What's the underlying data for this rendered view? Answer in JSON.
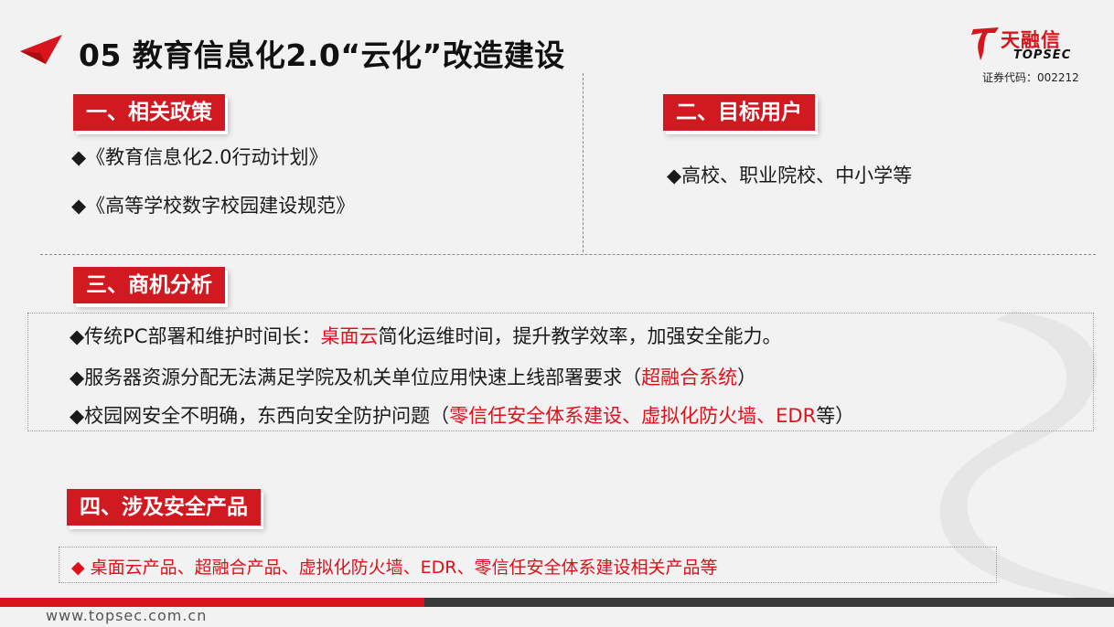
{
  "header": {
    "title": "05 教育信息化2.0“云化”改造建设"
  },
  "logo": {
    "cn": "天融信",
    "en": "TOPSEC",
    "stock_code": "证券代码：002212"
  },
  "sections": {
    "policy": {
      "label": "一、相关政策",
      "items": [
        "◆《教育信息化2.0行动计划》",
        "◆《高等学校数字校园建设规范》"
      ]
    },
    "users": {
      "label": "二、目标用户",
      "items": [
        "◆高校、职业院校、中小学等"
      ]
    },
    "analysis": {
      "label": "三、商机分析",
      "lines": [
        {
          "pre": "◆传统PC部署和维护时间长：",
          "highlight": "桌面云",
          "post": "简化运维时间，提升教学效率，加强安全能力。"
        },
        {
          "pre": "◆服务器资源分配无法满足学院及机关单位应用快速上线部署要求（",
          "highlight": "超融合系统",
          "post": "）"
        },
        {
          "pre": "◆校园网安全不明确，东西向安全防护问题（",
          "highlight": "零信任安全体系建设、虚拟化防火墙、EDR",
          "post": "等）"
        }
      ]
    },
    "products": {
      "label": "四、涉及安全产品",
      "text": "◆ 桌面云产品、超融合产品、虚拟化防火墙、EDR、零信任安全体系建设相关产品等"
    }
  },
  "footer": {
    "url": "www.topsec.com.cn"
  },
  "colors": {
    "accent_red": "#d01920",
    "highlight_red": "#e0101a",
    "footer_dark": "#3a3a3a"
  }
}
